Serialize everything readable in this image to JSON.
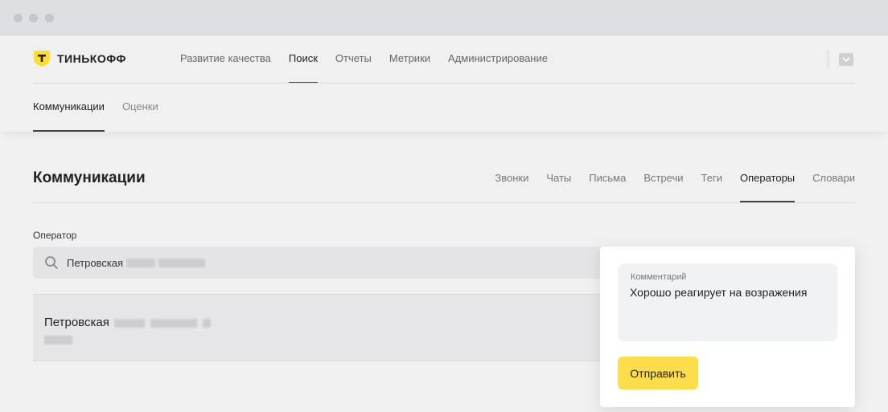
{
  "brand": {
    "name": "ТИНЬКОФФ",
    "shield_letter": "Т",
    "color": "#ffdd2d"
  },
  "topnav": {
    "items": [
      {
        "label": "Развитие качества",
        "active": false
      },
      {
        "label": "Поиск",
        "active": true
      },
      {
        "label": "Отчеты",
        "active": false
      },
      {
        "label": "Метрики",
        "active": false
      },
      {
        "label": "Администрирование",
        "active": false
      }
    ]
  },
  "subnav": {
    "items": [
      {
        "label": "Коммуникации",
        "active": true
      },
      {
        "label": "Оценки",
        "active": false
      }
    ]
  },
  "main": {
    "title": "Коммуникации",
    "tabs": [
      {
        "label": "Звонки",
        "active": false
      },
      {
        "label": "Чаты",
        "active": false
      },
      {
        "label": "Письма",
        "active": false
      },
      {
        "label": "Встречи",
        "active": false
      },
      {
        "label": "Теги",
        "active": false
      },
      {
        "label": "Операторы",
        "active": true
      },
      {
        "label": "Словари",
        "active": false
      }
    ],
    "operator_field": {
      "label": "Оператор",
      "value": "Петровская"
    },
    "result": {
      "name": "Петровская"
    }
  },
  "popover": {
    "comment_label": "Комментарий",
    "comment_text": "Хорошо реагирует на возражения",
    "submit_label": "Отправить",
    "submit_color": "#fbdc4a"
  }
}
